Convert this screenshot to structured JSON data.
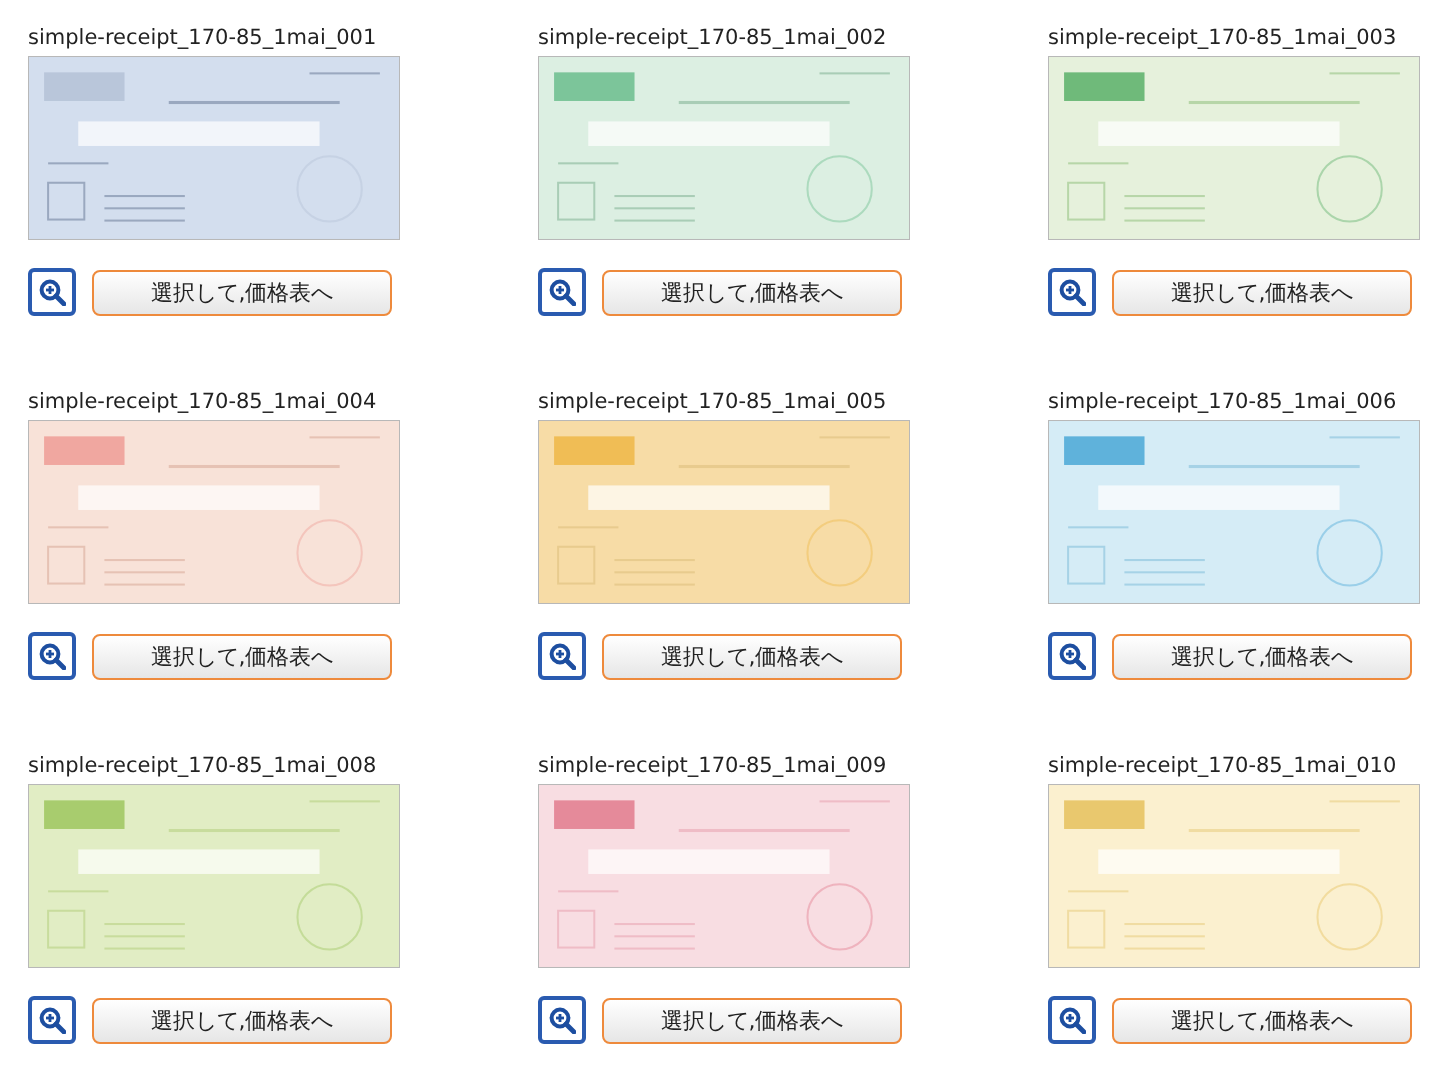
{
  "items": [
    {
      "title": "simple-receipt_170-85_1mai_001",
      "button": "選択して,価格表へ"
    },
    {
      "title": "simple-receipt_170-85_1mai_002",
      "button": "選択して,価格表へ"
    },
    {
      "title": "simple-receipt_170-85_1mai_003",
      "button": "選択して,価格表へ"
    },
    {
      "title": "simple-receipt_170-85_1mai_004",
      "button": "選択して,価格表へ"
    },
    {
      "title": "simple-receipt_170-85_1mai_005",
      "button": "選択して,価格表へ"
    },
    {
      "title": "simple-receipt_170-85_1mai_006",
      "button": "選択して,価格表へ"
    },
    {
      "title": "simple-receipt_170-85_1mai_008",
      "button": "選択して,価格表へ"
    },
    {
      "title": "simple-receipt_170-85_1mai_009",
      "button": "選択して,価格表へ"
    },
    {
      "title": "simple-receipt_170-85_1mai_010",
      "button": "選択して,価格表へ"
    }
  ]
}
